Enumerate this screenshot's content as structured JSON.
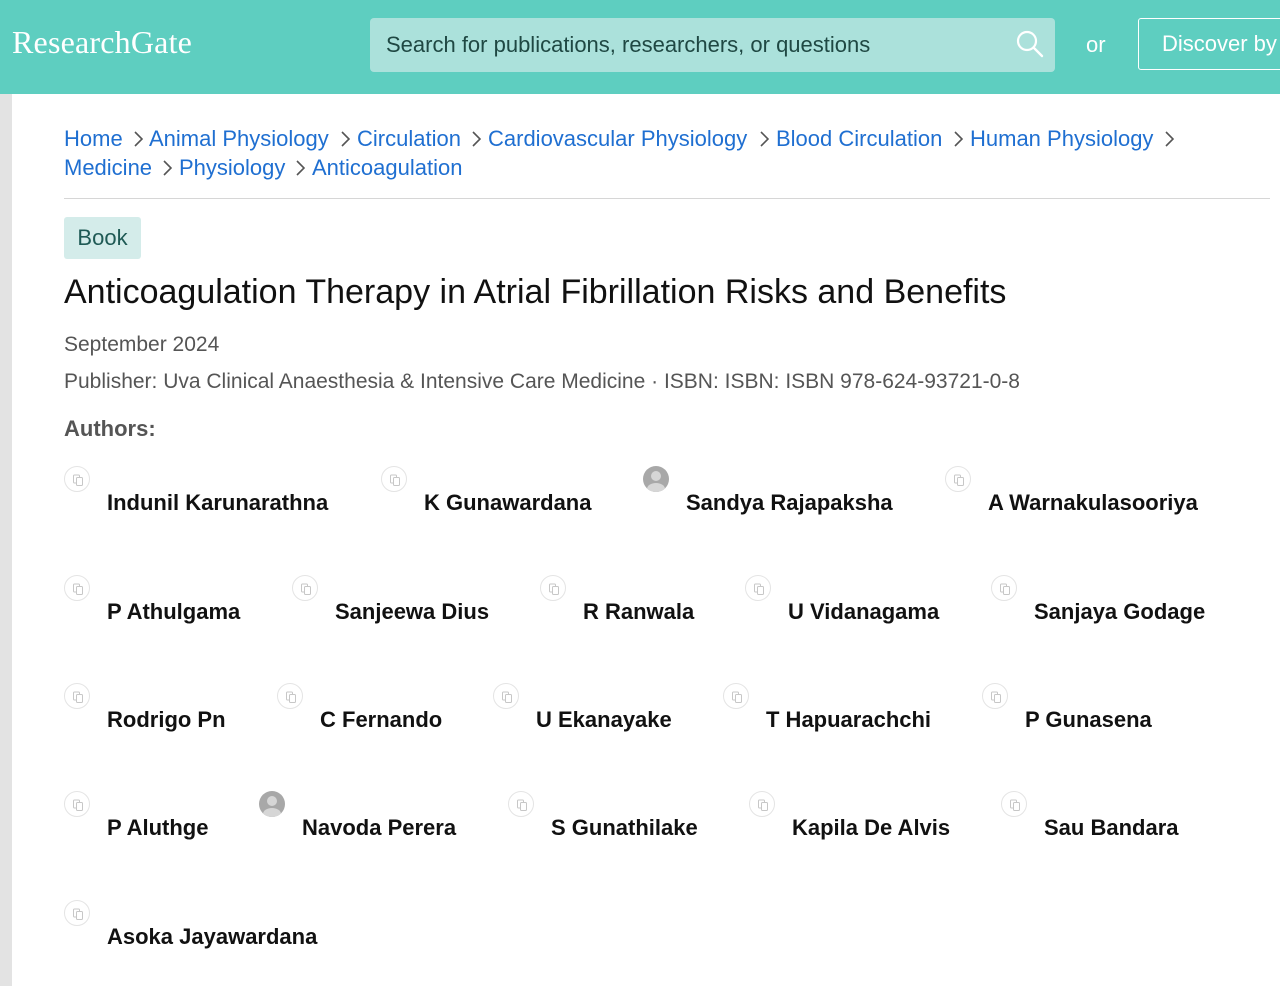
{
  "header": {
    "logo": "ResearchGate",
    "search_placeholder": "Search for publications, researchers, or questions",
    "or_label": "or",
    "discover_label": "Discover by"
  },
  "breadcrumbs": [
    "Home",
    "Animal Physiology",
    "Circulation",
    "Cardiovascular Physiology",
    "Blood Circulation",
    "Human Physiology",
    "Medicine",
    "Physiology",
    "Anticoagulation"
  ],
  "publication": {
    "type_badge": "Book",
    "title": "Anticoagulation Therapy in Atrial Fibrillation Risks and Benefits",
    "date": "September 2024",
    "publisher_line": "Publisher: Uva Clinical Anaesthesia & Intensive Care Medicine · ISBN: ISBN: ISBN 978-624-93721-0-8",
    "authors_label": "Authors:"
  },
  "authors": [
    {
      "name": "Indunil Karunarathna",
      "avatar": "placeholder-icon"
    },
    {
      "name": "K Gunawardana",
      "avatar": "placeholder-icon"
    },
    {
      "name": "Sandya Rajapaksha",
      "avatar": "profile-photo"
    },
    {
      "name": "A Warnakulasooriya",
      "avatar": "placeholder-icon"
    },
    {
      "name": "P Athulgama",
      "avatar": "placeholder-icon"
    },
    {
      "name": "Sanjeewa Dius",
      "avatar": "placeholder-icon"
    },
    {
      "name": "R Ranwala",
      "avatar": "placeholder-icon"
    },
    {
      "name": "U Vidanagama",
      "avatar": "placeholder-icon"
    },
    {
      "name": "Sanjaya Godage",
      "avatar": "placeholder-icon"
    },
    {
      "name": "Rodrigo Pn",
      "avatar": "placeholder-icon"
    },
    {
      "name": "C Fernando",
      "avatar": "placeholder-icon"
    },
    {
      "name": "U Ekanayake",
      "avatar": "placeholder-icon"
    },
    {
      "name": "T Hapuarachchi",
      "avatar": "placeholder-icon"
    },
    {
      "name": "P Gunasena",
      "avatar": "placeholder-icon"
    },
    {
      "name": "P Aluthge",
      "avatar": "placeholder-icon"
    },
    {
      "name": "Navoda Perera",
      "avatar": "profile-photo"
    },
    {
      "name": "S Gunathilake",
      "avatar": "placeholder-icon"
    },
    {
      "name": "Kapila De Alvis",
      "avatar": "placeholder-icon"
    },
    {
      "name": "Sau Bandara",
      "avatar": "placeholder-icon"
    },
    {
      "name": "Asoka Jayawardana",
      "avatar": "placeholder-icon"
    }
  ],
  "colors": {
    "header": "#5ecec0",
    "search_bg": "#abe1db",
    "link": "#1f6fd1",
    "badge_bg": "#d4ecea",
    "badge_text": "#1f5a55"
  }
}
